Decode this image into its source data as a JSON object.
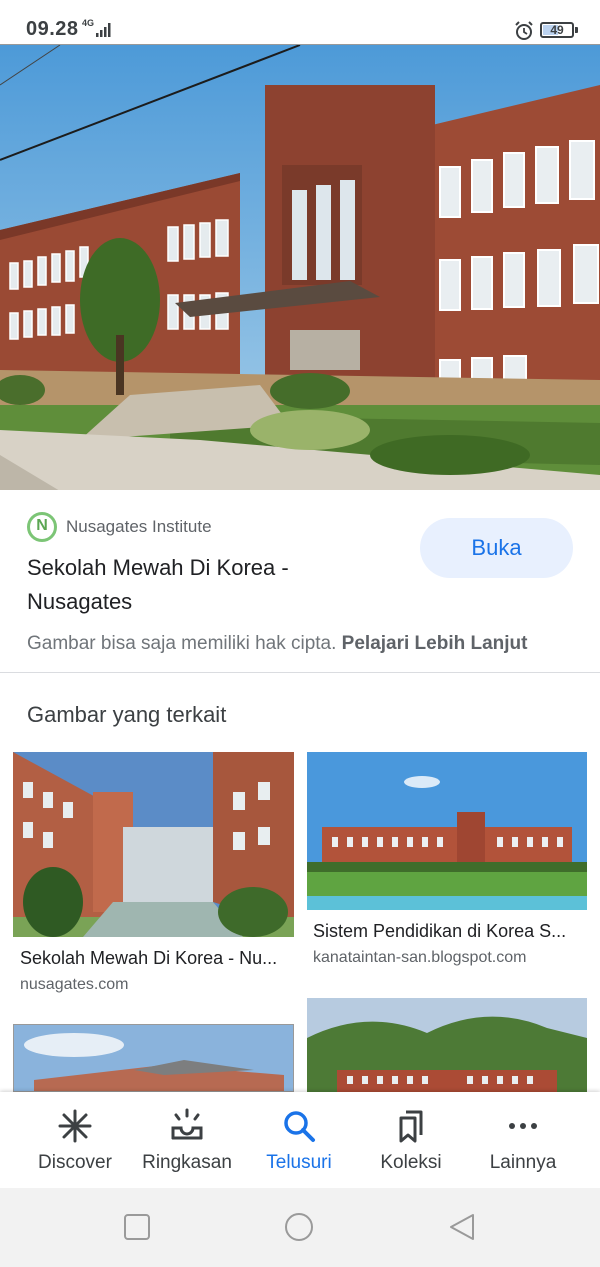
{
  "status_bar": {
    "time": "09.28",
    "network": "4G",
    "battery_level": "49",
    "alarm_icon": "alarm-clock-icon",
    "signal_icon": "signal-bars-icon"
  },
  "hero_image": {
    "description_icon": "building-photo"
  },
  "result": {
    "source_name": "Nusagates Institute",
    "source_logo_letter": "N",
    "title": "Sekolah Mewah Di Korea - Nusagates",
    "open_button": "Buka",
    "copyright_text": "Gambar bisa saja memiliki hak cipta.",
    "learn_more": "Pelajari Lebih Lanjut"
  },
  "related": {
    "heading": "Gambar yang terkait",
    "items": [
      {
        "title": "Sekolah Mewah Di Korea - Nu...",
        "source": "nusagates.com"
      },
      {
        "title": "Sistem Pendidikan di Korea S...",
        "source": "kanataintan-san.blogspot.com"
      },
      {
        "title": "",
        "source": ""
      },
      {
        "title": "",
        "source": ""
      }
    ]
  },
  "bottom_nav": {
    "items": [
      {
        "label": "Discover",
        "icon": "asterisk-icon"
      },
      {
        "label": "Ringkasan",
        "icon": "sunrise-icon"
      },
      {
        "label": "Telusuri",
        "icon": "search-icon",
        "active": true
      },
      {
        "label": "Koleksi",
        "icon": "bookmarks-icon"
      },
      {
        "label": "Lainnya",
        "icon": "more-icon"
      }
    ]
  },
  "colors": {
    "accent": "#1a73e8",
    "button_bg": "#e8f0fe",
    "logo_green": "#7cc576"
  }
}
